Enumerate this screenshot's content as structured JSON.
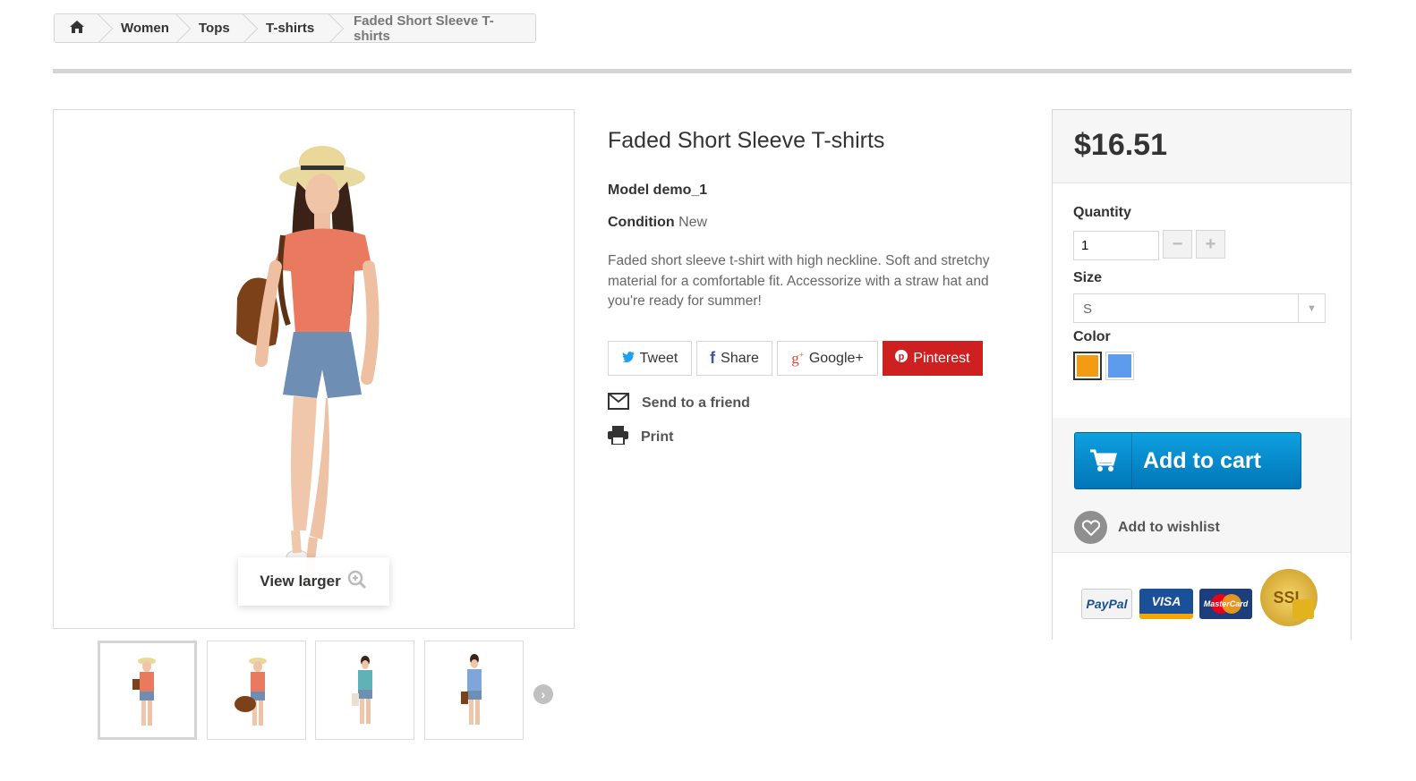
{
  "breadcrumb": {
    "items": [
      "Women",
      "Tops",
      "T-shirts"
    ],
    "current": "Faded Short Sleeve T-shirts"
  },
  "product": {
    "title": "Faded Short Sleeve T-shirts",
    "model_label": "Model",
    "model_value": "demo_1",
    "condition_label": "Condition",
    "condition_value": "New",
    "description": "Faded short sleeve t-shirt with high neckline. Soft and stretchy material for a comfortable fit. Accessorize with a straw hat and you're ready for summer!",
    "view_larger": "View larger"
  },
  "share": {
    "tweet": "Tweet",
    "share": "Share",
    "google": "Google+",
    "pinterest": "Pinterest"
  },
  "actions": {
    "send_friend": "Send to a friend",
    "print": "Print"
  },
  "buybox": {
    "price": "$16.51",
    "quantity_label": "Quantity",
    "quantity_value": "1",
    "size_label": "Size",
    "size_value": "S",
    "color_label": "Color",
    "colors": [
      "#f39c11",
      "#5d9cec"
    ],
    "add_to_cart": "Add to cart",
    "add_to_wishlist": "Add to wishlist"
  },
  "payments": {
    "paypal": "PayPal",
    "visa": "VISA",
    "mastercard": "MasterCard",
    "ssl": "SSL"
  },
  "theme": {
    "accent_blue": "#0a8ed0",
    "pinterest_red": "#ce1f21",
    "twitter_blue": "#1da1f2",
    "facebook_blue": "#3b5998",
    "google_red": "#dd4b39"
  }
}
